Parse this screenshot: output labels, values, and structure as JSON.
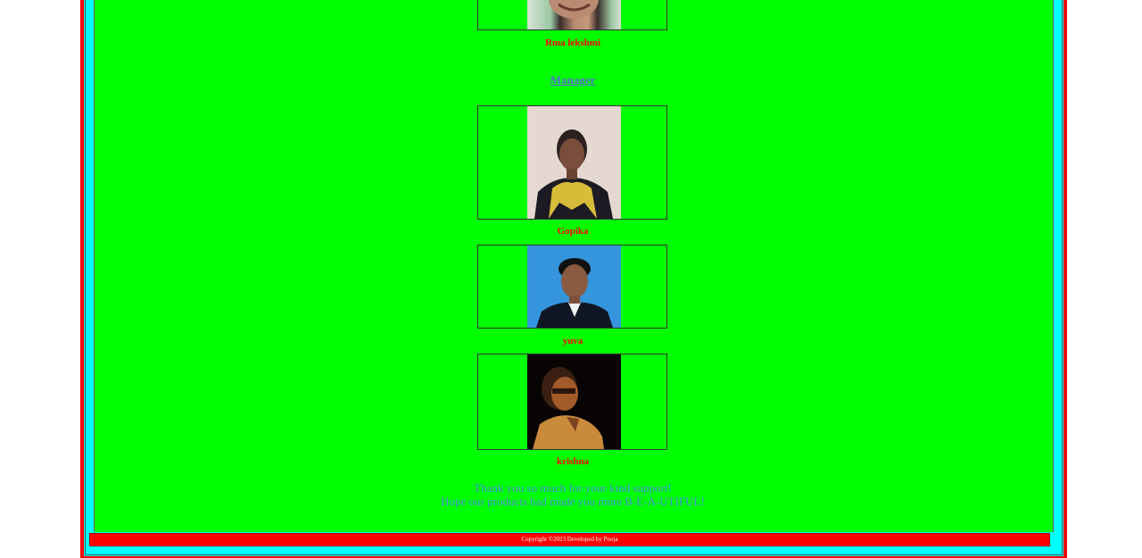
{
  "team": {
    "top_member": {
      "name": "Rma lekshmi"
    },
    "manager_heading": "Manager",
    "members": [
      {
        "name": "Gopika"
      },
      {
        "name": "yuva"
      },
      {
        "name": "krishna"
      }
    ]
  },
  "message": {
    "line1": "Thank you so much for your kind support!",
    "line2": "Hope our products had made you more B-E-A-UTIFUL!"
  },
  "footer": {
    "copyright": "Copyright ©2023 Developed by Pooja"
  },
  "colors": {
    "page_bg": "#ffffff",
    "frame_border": "#ff0000",
    "frame_fill": "#00ffff",
    "content_bg": "#00ff00",
    "name_text": "#ff0000",
    "heading_text": "#5a6ad6",
    "message_text": "#4d88e0",
    "footer_bg": "#ff0000",
    "footer_text": "#ffffff"
  }
}
